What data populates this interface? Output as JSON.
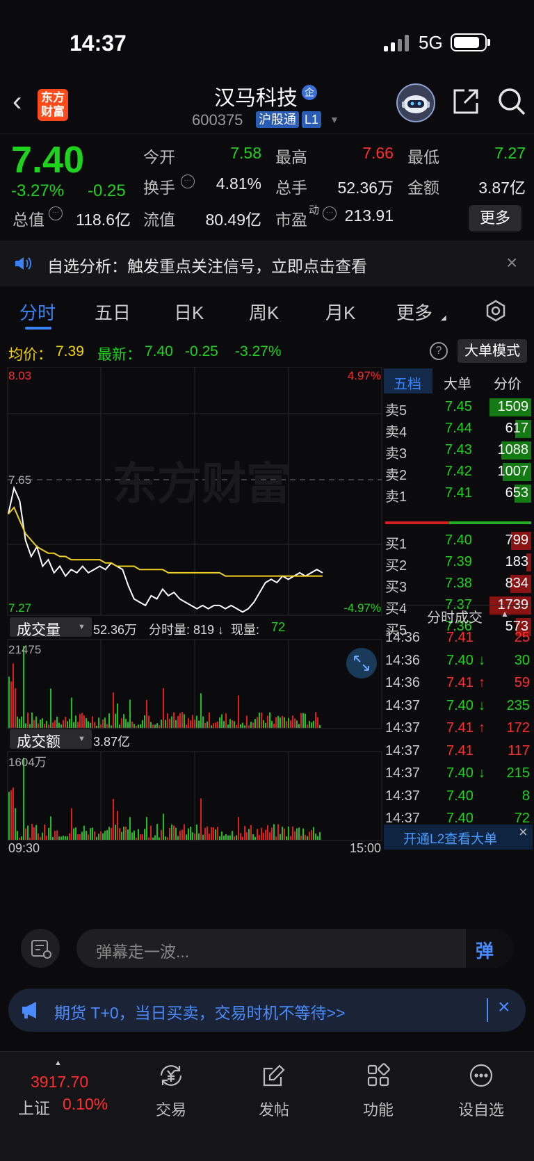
{
  "status": {
    "time": "14:37",
    "network": "5G"
  },
  "header": {
    "logo_text": "东方\n财富",
    "stock_name": "汉马科技",
    "badge_qi": "企",
    "stock_code": "600375",
    "badge_hgt": "沪股通",
    "badge_l1": "L1"
  },
  "quote": {
    "price": "7.40",
    "change_pct": "-3.27%",
    "change": "-0.25",
    "today_open_label": "今开",
    "today_open": "7.58",
    "high_label": "最高",
    "high": "7.66",
    "low_label": "最低",
    "low": "7.27",
    "turnover_label": "换手",
    "turnover": "4.81%",
    "volume_label": "总手",
    "volume": "52.36万",
    "amount_label": "金额",
    "amount": "3.87亿",
    "mktcap_label": "总值",
    "mktcap": "118.6亿",
    "float_label": "流值",
    "float": "80.49亿",
    "pe_label": "市盈",
    "pe_sup": "动",
    "pe": "213.91",
    "more_label": "更多"
  },
  "notice": {
    "text": "自选分析：触发重点关注信号，立即点击查看"
  },
  "tabs": [
    "分时",
    "五日",
    "日K",
    "周K",
    "月K",
    "更多"
  ],
  "avg": {
    "avg_label": "均价：",
    "avg_value": "7.39",
    "latest_label": "最新：",
    "latest_value": "7.40",
    "change": "-0.25",
    "change_pct": "-3.27%",
    "big_order": "大单模式"
  },
  "chart": {
    "top_price": "8.03",
    "top_pct": "4.97%",
    "mid_price": "7.65",
    "bottom_price": "7.27",
    "bottom_pct": "-4.97%",
    "watermark": "东方财富",
    "vol_label": "成交量",
    "vol_info": "52.36万",
    "vol_fen": "分时量: 819 ↓",
    "vol_now_label": "现量:",
    "vol_now": "72",
    "vol_max": "21475",
    "amt_label": "成交额",
    "amt_info": "3.87亿",
    "amt_max": "1604万",
    "time_start": "09:30",
    "time_end": "15:00"
  },
  "chart_data": {
    "type": "line",
    "price_range": [
      7.27,
      8.03
    ],
    "prev_close": 7.65,
    "series": [
      {
        "values": [
          7.58,
          7.66,
          7.62,
          7.5,
          7.45,
          7.48,
          7.42,
          7.44,
          7.4,
          7.42,
          7.39,
          7.41,
          7.4,
          7.42,
          7.4,
          7.41,
          7.42,
          7.41,
          7.43,
          7.42,
          7.41,
          7.36,
          7.32,
          7.31,
          7.3,
          7.33,
          7.32,
          7.35,
          7.33,
          7.34,
          7.32,
          7.31,
          7.3,
          7.29,
          7.3,
          7.29,
          7.3,
          7.3,
          7.29,
          7.3,
          7.29,
          7.28,
          7.29,
          7.31,
          7.34,
          7.37,
          7.38,
          7.37,
          7.39,
          7.38,
          7.39,
          7.4,
          7.39,
          7.4,
          7.41,
          7.4
        ]
      },
      {
        "values": [
          7.58,
          7.6,
          7.56,
          7.52,
          7.5,
          7.48,
          7.47,
          7.46,
          7.46,
          7.45,
          7.45,
          7.44,
          7.44,
          7.44,
          7.44,
          7.44,
          7.44,
          7.43,
          7.43,
          7.42,
          7.42,
          7.42,
          7.42,
          7.41,
          7.41,
          7.41,
          7.41,
          7.41,
          7.4,
          7.4,
          7.4,
          7.4,
          7.4,
          7.4,
          7.4,
          7.4,
          7.4,
          7.4,
          7.39,
          7.39,
          7.39,
          7.39,
          7.39,
          7.39,
          7.39,
          7.39,
          7.39,
          7.39,
          7.39,
          7.39,
          7.39,
          7.39,
          7.39,
          7.39,
          7.39,
          7.39
        ]
      }
    ]
  },
  "order_book": {
    "tabs": [
      "五档",
      "大单",
      "分价"
    ],
    "sell": [
      {
        "label": "卖5",
        "price": "7.45",
        "vol": "1509",
        "bar": 1.0
      },
      {
        "label": "卖4",
        "price": "7.44",
        "vol": "617",
        "bar": 0.38
      },
      {
        "label": "卖3",
        "price": "7.43",
        "vol": "1088",
        "bar": 0.72
      },
      {
        "label": "卖2",
        "price": "7.42",
        "vol": "1007",
        "bar": 0.68
      },
      {
        "label": "卖1",
        "price": "7.41",
        "vol": "653",
        "bar": 0.4
      }
    ],
    "buy": [
      {
        "label": "买1",
        "price": "7.40",
        "vol": "799",
        "bar": 0.48
      },
      {
        "label": "买2",
        "price": "7.39",
        "vol": "183",
        "bar": 0.12
      },
      {
        "label": "买3",
        "price": "7.38",
        "vol": "834",
        "bar": 0.5
      },
      {
        "label": "买4",
        "price": "7.37",
        "vol": "1739",
        "bar": 1.0
      },
      {
        "label": "买5",
        "price": "7.36",
        "vol": "573",
        "bar": 0.36
      }
    ],
    "trades_title": "分时成交",
    "trades": [
      {
        "time": "14:36",
        "price": "7.41",
        "arrow": "",
        "vol": "25",
        "color": "red"
      },
      {
        "time": "14:36",
        "price": "7.40",
        "arrow": "↓",
        "vol": "30",
        "color": "green"
      },
      {
        "time": "14:36",
        "price": "7.41",
        "arrow": "↑",
        "vol": "59",
        "color": "red"
      },
      {
        "time": "14:37",
        "price": "7.40",
        "arrow": "↓",
        "vol": "235",
        "color": "green"
      },
      {
        "time": "14:37",
        "price": "7.41",
        "arrow": "↑",
        "vol": "172",
        "color": "red"
      },
      {
        "time": "14:37",
        "price": "7.41",
        "arrow": "",
        "vol": "117",
        "color": "red"
      },
      {
        "time": "14:37",
        "price": "7.40",
        "arrow": "↓",
        "vol": "215",
        "color": "green"
      },
      {
        "time": "14:37",
        "price": "7.40",
        "arrow": "",
        "vol": "8",
        "color": "green"
      },
      {
        "time": "14:37",
        "price": "7.40",
        "arrow": "",
        "vol": "72",
        "color": "green"
      }
    ],
    "l2_label": "开通L2查看大单"
  },
  "danmu": {
    "placeholder": "弹幕走一波...",
    "send_label": "弹"
  },
  "ad": {
    "text": "期货 T+0，当日买卖，交易时机不等待>>"
  },
  "bottom_nav": {
    "index_value": "3917.70",
    "index_name": "上证",
    "index_pct": "0.10%",
    "items": [
      "交易",
      "发帖",
      "功能",
      "设自选"
    ]
  }
}
